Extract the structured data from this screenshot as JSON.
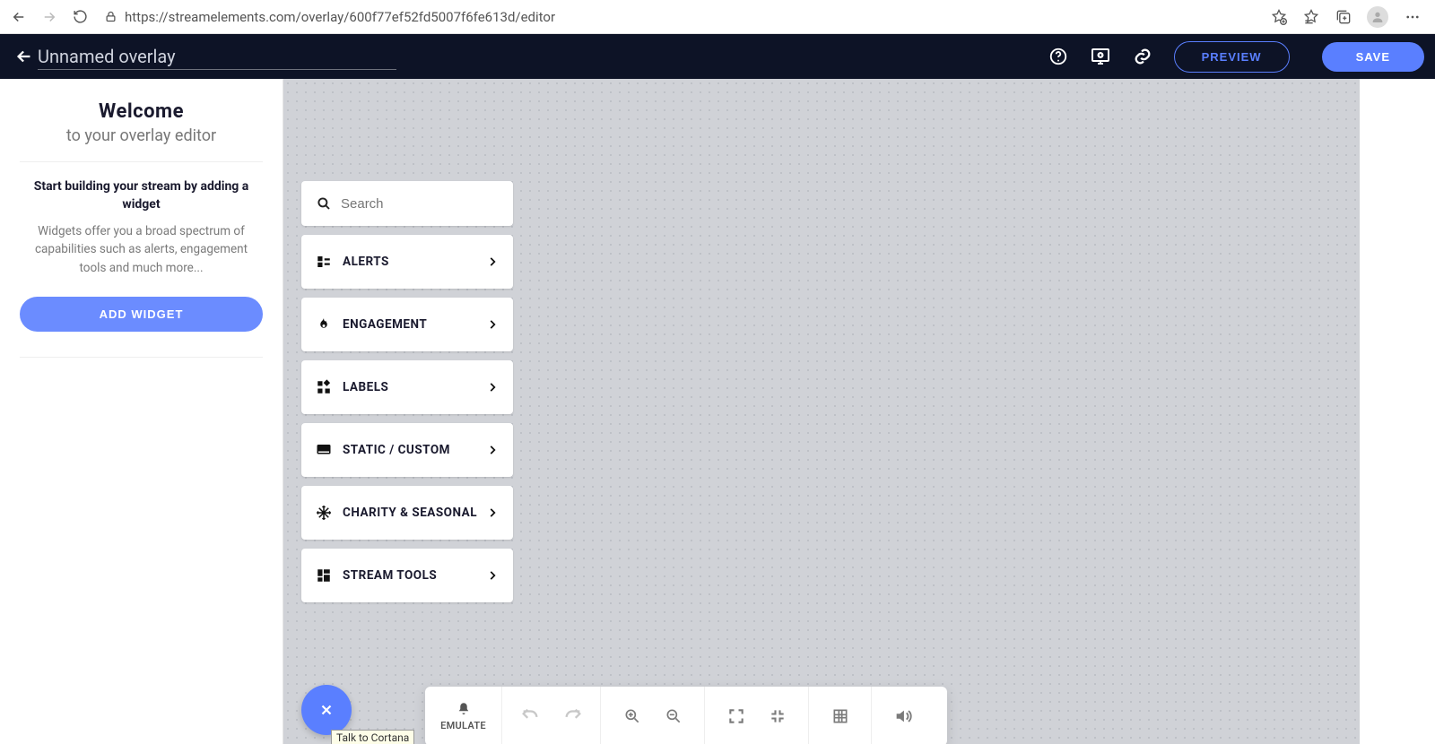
{
  "browser": {
    "url": "https://streamelements.com/overlay/600f77ef52fd5007f6fe613d/editor"
  },
  "header": {
    "title": "Unnamed overlay",
    "preview": "PREVIEW",
    "save": "SAVE"
  },
  "sidebar": {
    "welcome": "Welcome",
    "subtitle": "to your overlay editor",
    "heading": "Start building your stream by adding a widget",
    "desc": "Widgets offer you a broad spectrum of capabilities such as alerts, engagement tools and much more...",
    "add_widget": "ADD WIDGET"
  },
  "widget_panel": {
    "search_placeholder": "Search",
    "categories": [
      {
        "label": "ALERTS"
      },
      {
        "label": "ENGAGEMENT"
      },
      {
        "label": "LABELS"
      },
      {
        "label": "STATIC / CUSTOM"
      },
      {
        "label": "CHARITY & SEASONAL"
      },
      {
        "label": "STREAM TOOLS"
      }
    ]
  },
  "bottombar": {
    "emulate": "EMULATE"
  },
  "tooltip": {
    "cortana": "Talk to Cortana"
  }
}
